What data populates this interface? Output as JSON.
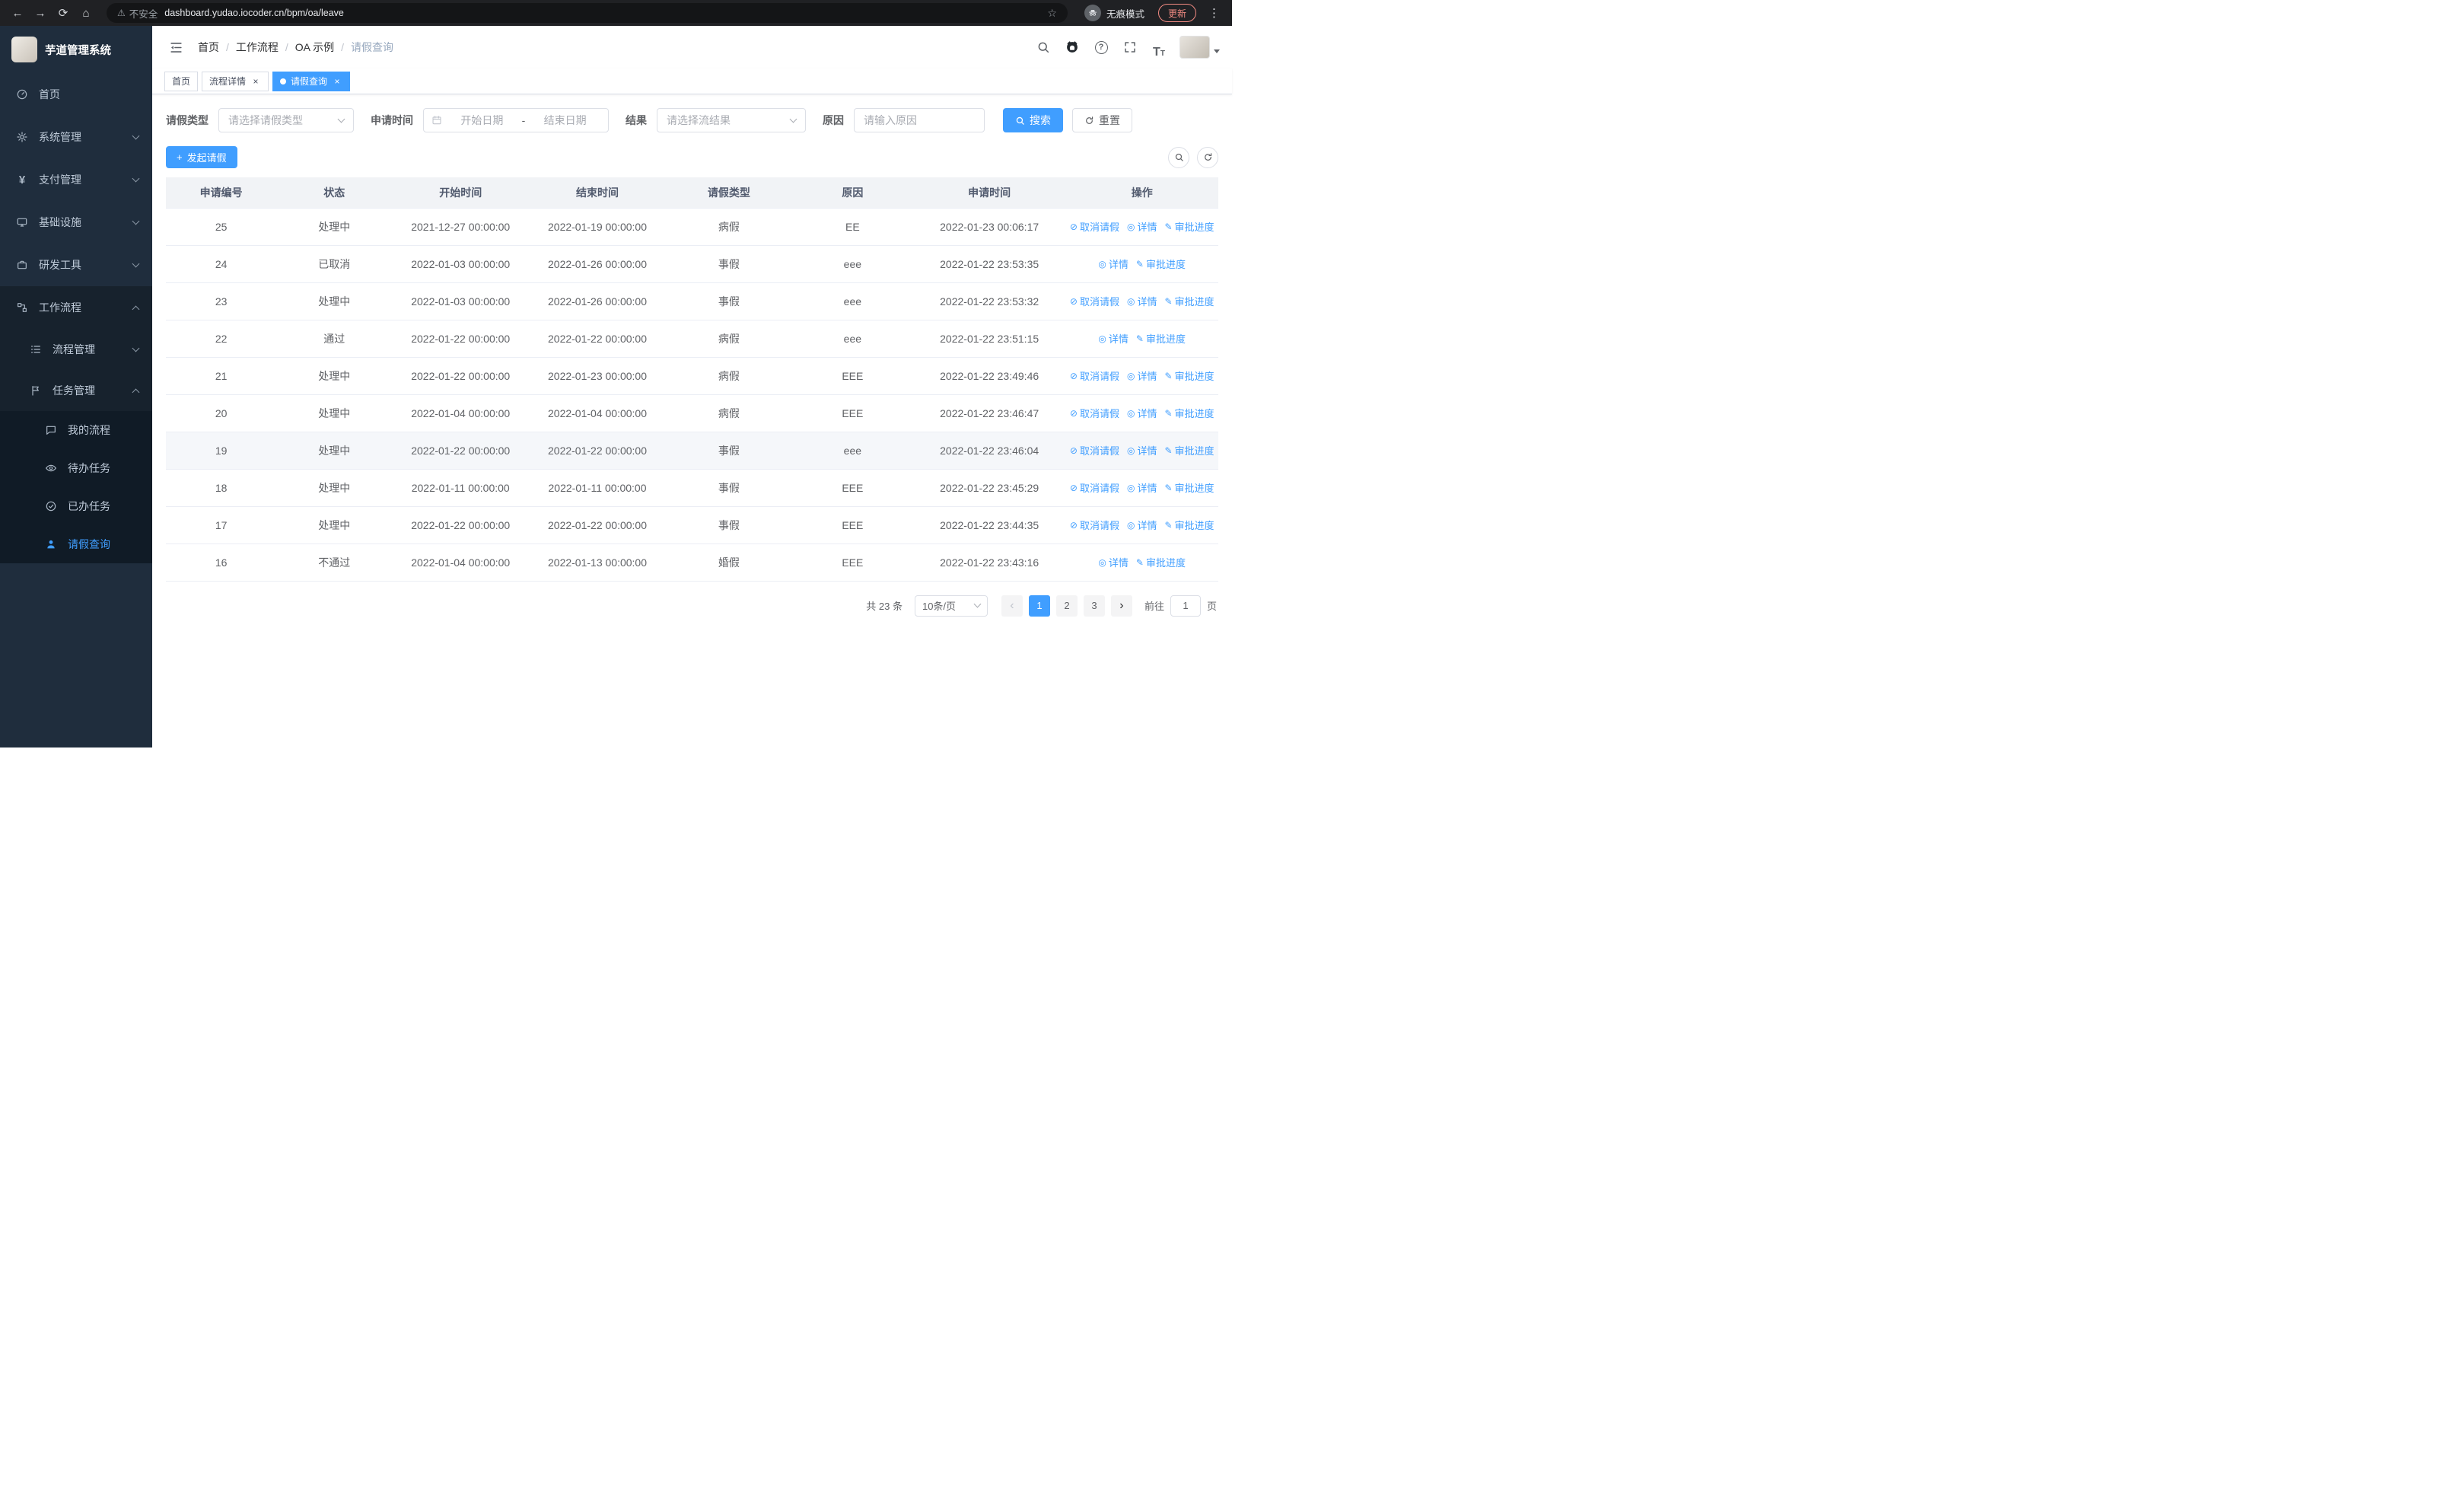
{
  "browser": {
    "security_label": "不安全",
    "url": "dashboard.yudao.iocoder.cn/bpm/oa/leave",
    "incognito_label": "无痕模式",
    "update_label": "更新"
  },
  "sidebar": {
    "title": "芋道管理系统",
    "items": [
      {
        "label": "首页"
      },
      {
        "label": "系统管理"
      },
      {
        "label": "支付管理"
      },
      {
        "label": "基础设施"
      },
      {
        "label": "研发工具"
      },
      {
        "label": "工作流程"
      }
    ],
    "workflow_children": [
      {
        "label": "流程管理"
      },
      {
        "label": "任务管理"
      }
    ],
    "task_children": [
      {
        "label": "我的流程"
      },
      {
        "label": "待办任务"
      },
      {
        "label": "已办任务"
      },
      {
        "label": "请假查询"
      }
    ]
  },
  "header": {
    "breadcrumb": [
      "首页",
      "工作流程",
      "OA 示例",
      "请假查询"
    ]
  },
  "tabs": [
    {
      "label": "首页"
    },
    {
      "label": "流程详情"
    },
    {
      "label": "请假查询"
    }
  ],
  "filters": {
    "leave_type_label": "请假类型",
    "leave_type_placeholder": "请选择请假类型",
    "apply_time_label": "申请时间",
    "start_date_placeholder": "开始日期",
    "date_separator": "-",
    "end_date_placeholder": "结束日期",
    "result_label": "结果",
    "result_placeholder": "请选择流结果",
    "reason_label": "原因",
    "reason_placeholder": "请输入原因",
    "search_button": "搜索",
    "reset_button": "重置"
  },
  "toolbar": {
    "create_button": "发起请假"
  },
  "table": {
    "headers": [
      "申请编号",
      "状态",
      "开始时间",
      "结束时间",
      "请假类型",
      "原因",
      "申请时间",
      "操作"
    ],
    "action_labels": {
      "cancel": "取消请假",
      "detail": "详情",
      "progress": "审批进度"
    },
    "rows": [
      {
        "id": "25",
        "status": "处理中",
        "start": "2021-12-27 00:00:00",
        "end": "2022-01-19 00:00:00",
        "type": "病假",
        "reason": "EE",
        "apply_time": "2022-01-23 00:06:17",
        "actions": [
          "cancel",
          "detail",
          "progress"
        ]
      },
      {
        "id": "24",
        "status": "已取消",
        "start": "2022-01-03 00:00:00",
        "end": "2022-01-26 00:00:00",
        "type": "事假",
        "reason": "eee",
        "apply_time": "2022-01-22 23:53:35",
        "actions": [
          "detail",
          "progress"
        ]
      },
      {
        "id": "23",
        "status": "处理中",
        "start": "2022-01-03 00:00:00",
        "end": "2022-01-26 00:00:00",
        "type": "事假",
        "reason": "eee",
        "apply_time": "2022-01-22 23:53:32",
        "actions": [
          "cancel",
          "detail",
          "progress"
        ]
      },
      {
        "id": "22",
        "status": "通过",
        "start": "2022-01-22 00:00:00",
        "end": "2022-01-22 00:00:00",
        "type": "病假",
        "reason": "eee",
        "apply_time": "2022-01-22 23:51:15",
        "actions": [
          "detail",
          "progress"
        ]
      },
      {
        "id": "21",
        "status": "处理中",
        "start": "2022-01-22 00:00:00",
        "end": "2022-01-23 00:00:00",
        "type": "病假",
        "reason": "EEE",
        "apply_time": "2022-01-22 23:49:46",
        "actions": [
          "cancel",
          "detail",
          "progress"
        ]
      },
      {
        "id": "20",
        "status": "处理中",
        "start": "2022-01-04 00:00:00",
        "end": "2022-01-04 00:00:00",
        "type": "病假",
        "reason": "EEE",
        "apply_time": "2022-01-22 23:46:47",
        "actions": [
          "cancel",
          "detail",
          "progress"
        ]
      },
      {
        "id": "19",
        "status": "处理中",
        "start": "2022-01-22 00:00:00",
        "end": "2022-01-22 00:00:00",
        "type": "事假",
        "reason": "eee",
        "apply_time": "2022-01-22 23:46:04",
        "actions": [
          "cancel",
          "detail",
          "progress"
        ],
        "highlighted": true
      },
      {
        "id": "18",
        "status": "处理中",
        "start": "2022-01-11 00:00:00",
        "end": "2022-01-11 00:00:00",
        "type": "事假",
        "reason": "EEE",
        "apply_time": "2022-01-22 23:45:29",
        "actions": [
          "cancel",
          "detail",
          "progress"
        ]
      },
      {
        "id": "17",
        "status": "处理中",
        "start": "2022-01-22 00:00:00",
        "end": "2022-01-22 00:00:00",
        "type": "事假",
        "reason": "EEE",
        "apply_time": "2022-01-22 23:44:35",
        "actions": [
          "cancel",
          "detail",
          "progress"
        ]
      },
      {
        "id": "16",
        "status": "不通过",
        "start": "2022-01-04 00:00:00",
        "end": "2022-01-13 00:00:00",
        "type": "婚假",
        "reason": "EEE",
        "apply_time": "2022-01-22 23:43:16",
        "actions": [
          "detail",
          "progress"
        ]
      }
    ]
  },
  "pagination": {
    "total": "共 23 条",
    "page_size": "10条/页",
    "pages": [
      "1",
      "2",
      "3"
    ],
    "active_page": "1",
    "goto_label": "前往",
    "goto_value": "1",
    "unit_label": "页"
  }
}
